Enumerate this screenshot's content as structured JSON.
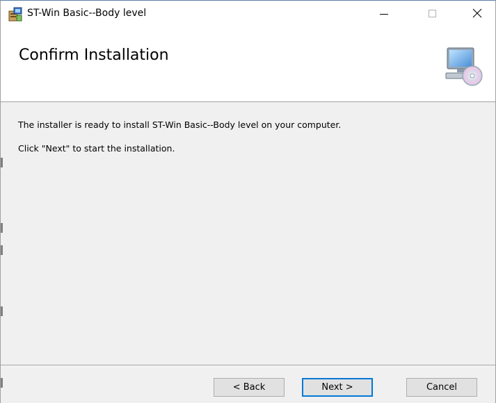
{
  "window": {
    "title": "ST-Win Basic--Body level",
    "minimize_glyph": "—",
    "maximize_glyph": "☐",
    "close_glyph": "✕"
  },
  "header": {
    "title": "Confirm Installation",
    "icon": "computer-cd-icon"
  },
  "content": {
    "line1": "The installer is ready to install ST-Win Basic--Body level on your computer.",
    "line2": "Click \"Next\" to start the installation."
  },
  "buttons": {
    "back": "< Back",
    "next": "Next >",
    "cancel": "Cancel"
  },
  "colors": {
    "accent": "#0078d7",
    "background": "#f0f0f0",
    "header_bg": "#ffffff"
  }
}
